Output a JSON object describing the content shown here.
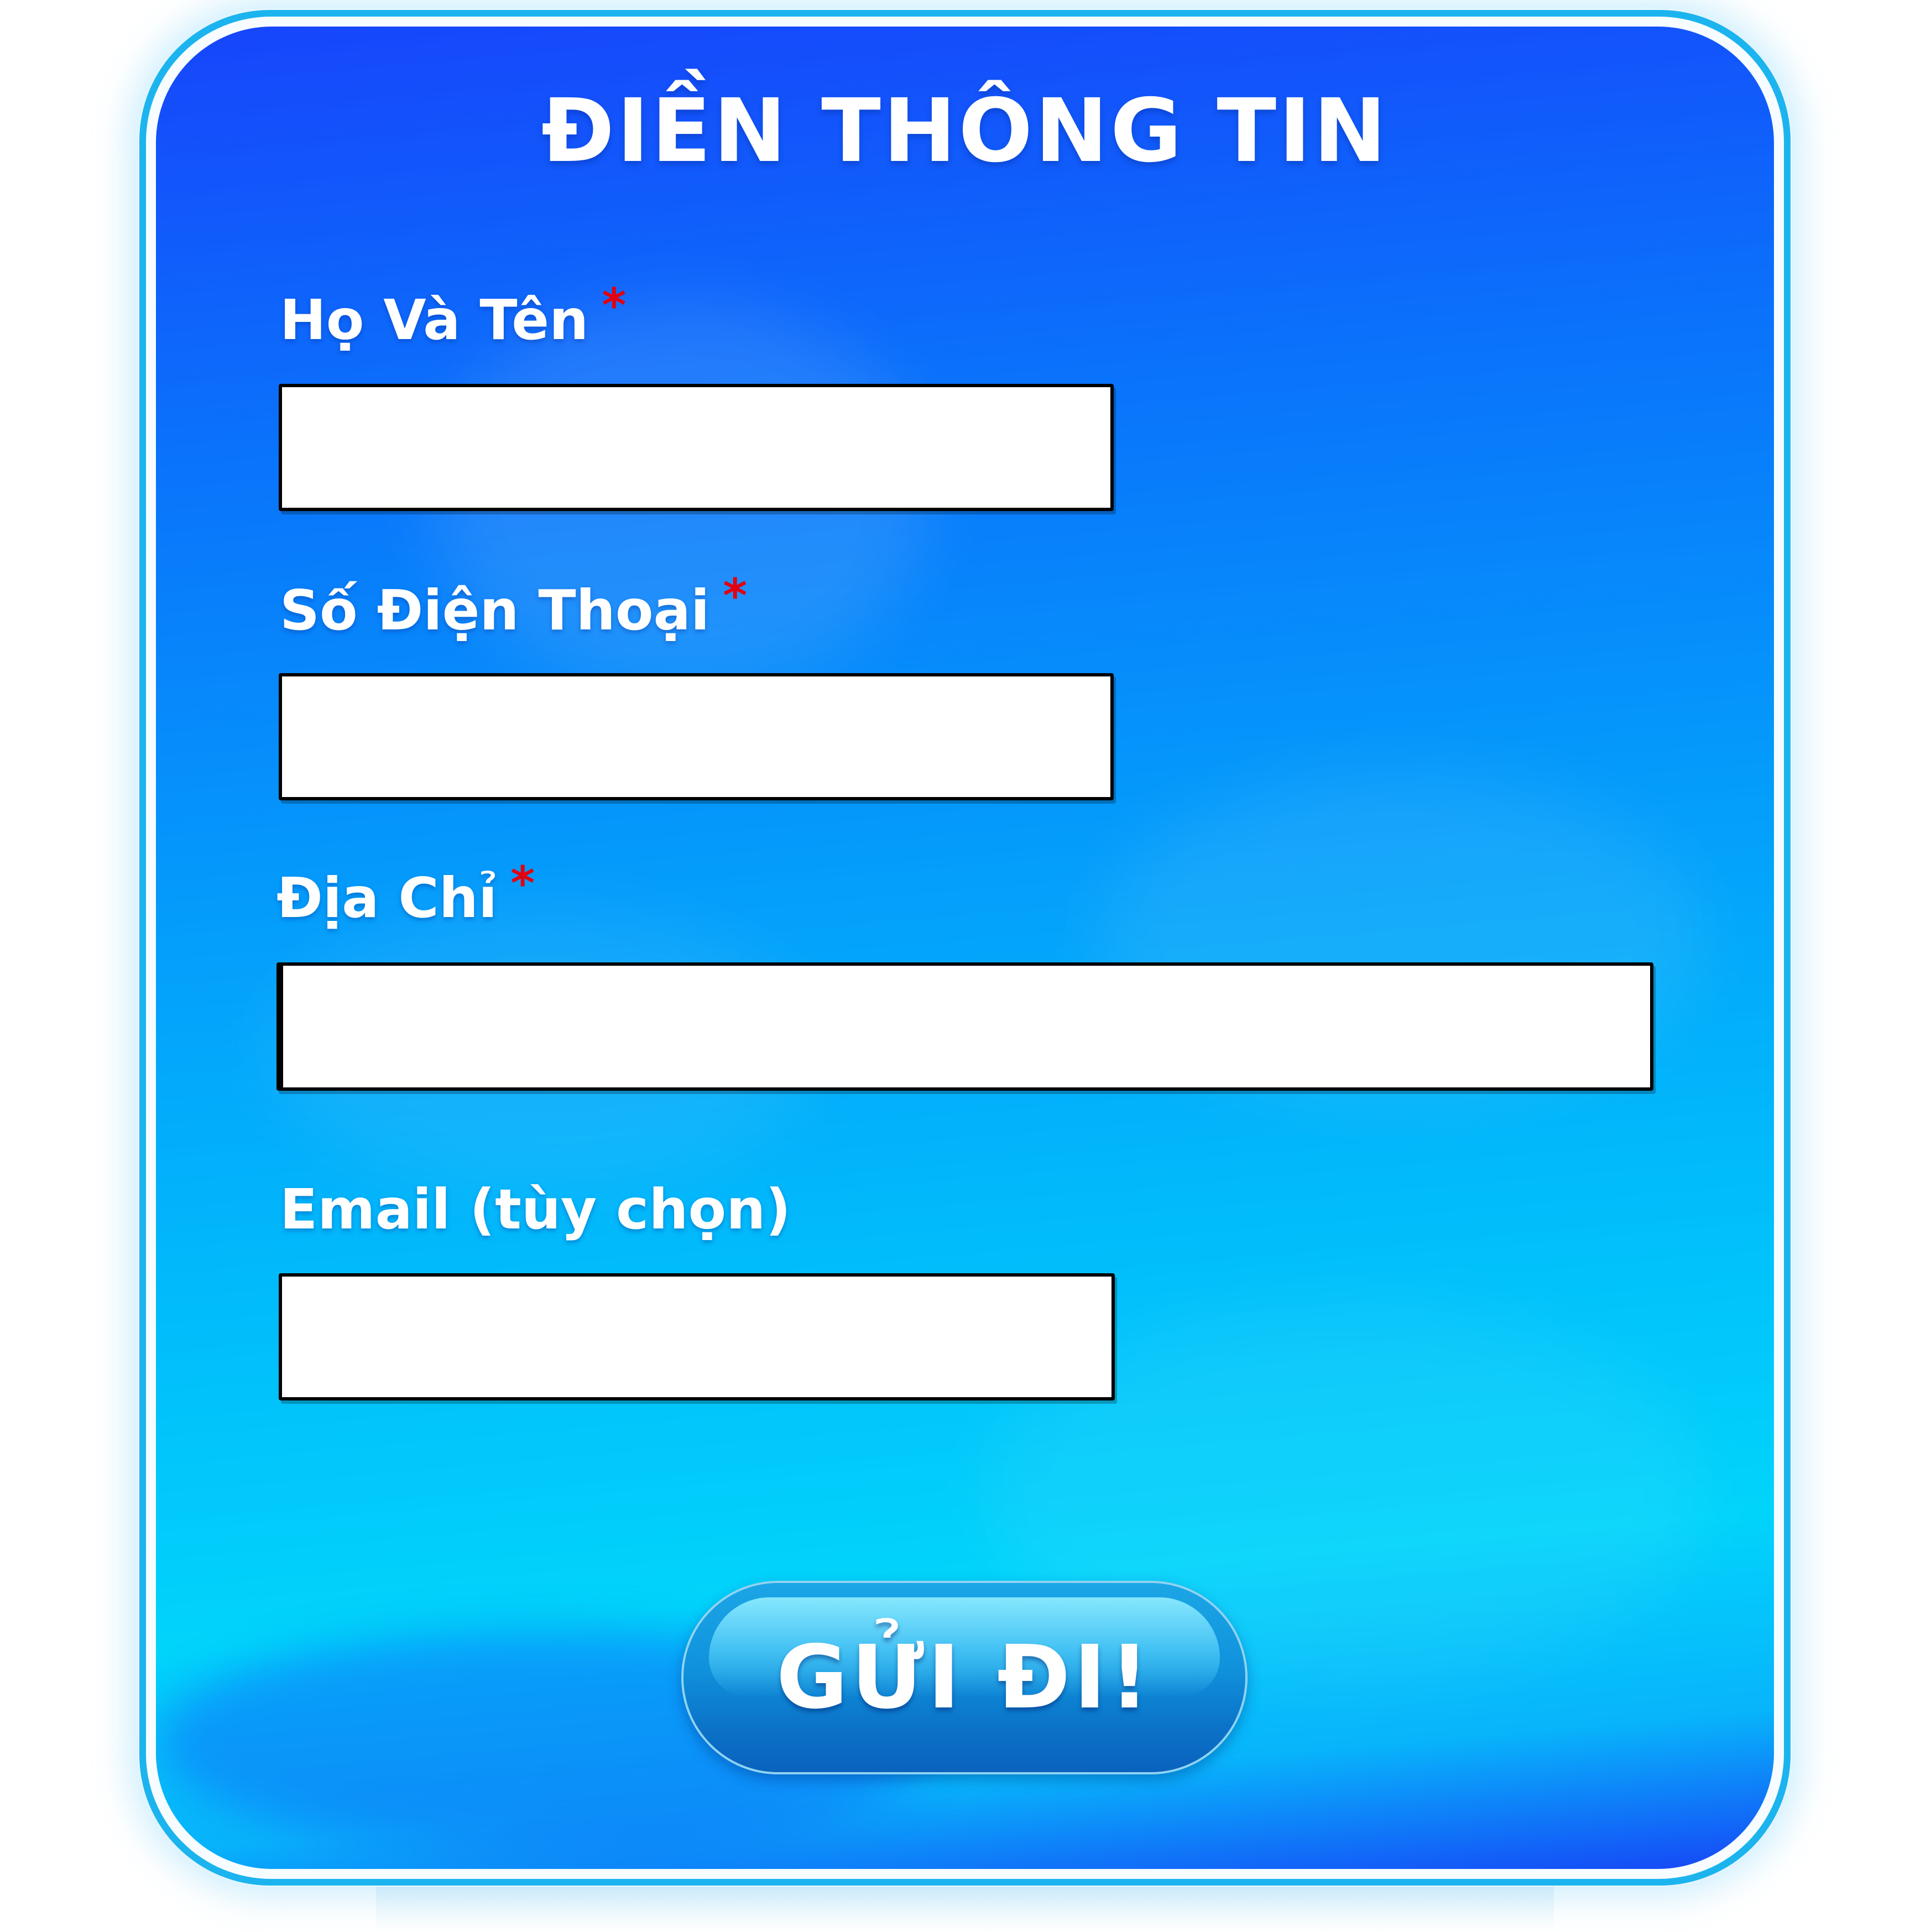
{
  "form": {
    "title": "ĐIỀN THÔNG TIN",
    "required_mark": "*",
    "fields": [
      {
        "label": "Họ Và Tên",
        "required": true,
        "value": "",
        "placeholder": ""
      },
      {
        "label": "Số Điện Thoại",
        "required": true,
        "value": "",
        "placeholder": ""
      },
      {
        "label": "Địa Chỉ",
        "required": true,
        "value": "",
        "placeholder": ""
      },
      {
        "label": "Email (tùy chọn)",
        "required": false,
        "value": "",
        "placeholder": ""
      }
    ],
    "submit_label": "GỬI ĐI!"
  },
  "colors": {
    "frame": "#1cb4ee",
    "background_top": "#1745fb",
    "background_mid": "#01bcfb",
    "input_fill": "#ffffff",
    "input_border": "#000000",
    "required_mark": "#e3000f",
    "button": "#1092dc",
    "text": "#ffffff"
  }
}
